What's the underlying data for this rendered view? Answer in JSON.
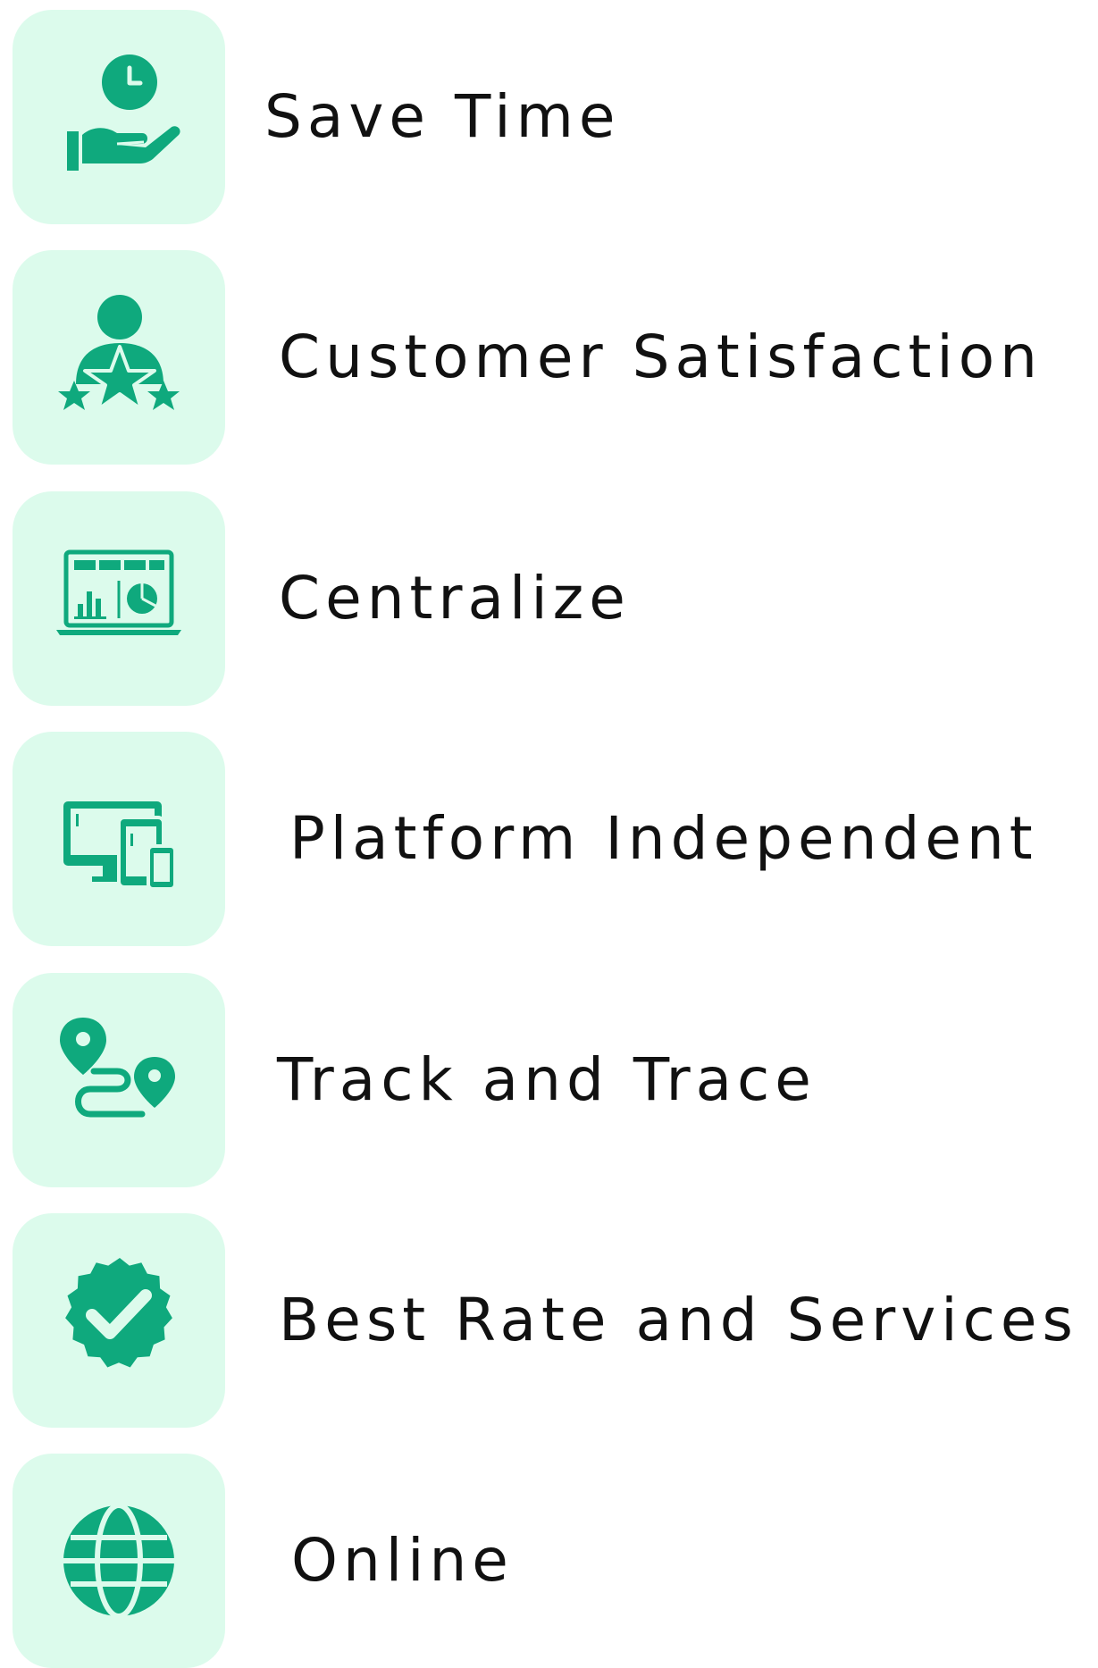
{
  "accent_color": "#0fa97d",
  "tile_color": "#dcfbec",
  "features": [
    {
      "label": "Save Time",
      "icon": "hand-clock-icon"
    },
    {
      "label": "Customer Satisfaction",
      "icon": "customer-stars-icon"
    },
    {
      "label": "Centralize",
      "icon": "laptop-dashboard-icon"
    },
    {
      "label": "Platform Independent",
      "icon": "multi-device-icon"
    },
    {
      "label": "Track and Trace",
      "icon": "route-pins-icon"
    },
    {
      "label": "Best Rate and Services",
      "icon": "verified-badge-icon"
    },
    {
      "label": "Online",
      "icon": "globe-icon"
    }
  ]
}
